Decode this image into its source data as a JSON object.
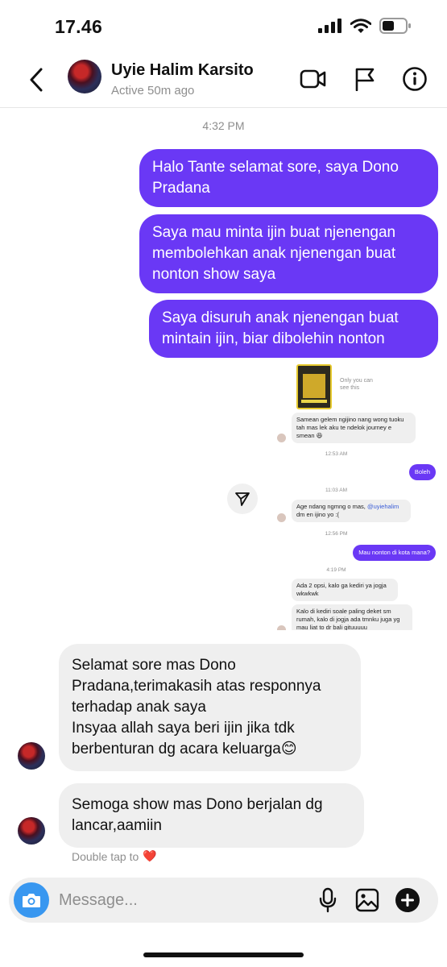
{
  "status_bar": {
    "time": "17.46"
  },
  "header": {
    "contact_name": "Uyie Halim Karsito",
    "contact_status": "Active 50m ago",
    "icons": [
      "back-icon",
      "video-call-icon",
      "flag-icon",
      "info-icon"
    ]
  },
  "conversation": {
    "timestamp": "4:32 PM",
    "outgoing": [
      {
        "text": "Halo Tante selamat sore, saya Dono Pradana"
      },
      {
        "text": "Saya mau minta ijin buat njenengan membolehkan anak njenengan buat nonton show saya"
      },
      {
        "text": "Saya disuruh anak njenengan buat mintain ijin, biar dibolehin nonton"
      }
    ],
    "shared_screenshot": {
      "only_you_can_see": "Only you can see this",
      "messages": [
        {
          "dir": "in",
          "text": "Samean gelem ngijino nang wong tuoku tah mas lek aku te ndelok journey e smean 😆"
        },
        {
          "dir": "time",
          "text": "12:53 AM"
        },
        {
          "dir": "out",
          "text": "Boleh"
        },
        {
          "dir": "time",
          "text": "11:03 AM"
        },
        {
          "dir": "in",
          "text": "Age ndang ngmng o mas, ",
          "mention": "@uyiehalim",
          "text_after": " dm en ijino yo :("
        },
        {
          "dir": "time",
          "text": "12:56 PM"
        },
        {
          "dir": "out",
          "text": "Mau nonton di kota mana?"
        },
        {
          "dir": "time",
          "text": "4:19 PM"
        },
        {
          "dir": "in",
          "text": "Ada 2 opsi, kalo ga kediri ya jogja wkwkwk"
        },
        {
          "dir": "in",
          "text": "Kalo di kediri soale paling deket sm rumah, kalo di jogja ada tmnku juga yg mau liat to dr bali gituuuuu"
        }
      ]
    },
    "incoming": [
      {
        "lines": [
          "Selamat sore mas Dono",
          "Pradana,terimakasih atas responnya",
          "terhadap anak saya",
          "Insyaa allah saya beri ijin jika tdk",
          "berbenturan dg acara keluarga😊"
        ]
      },
      {
        "lines": [
          "Semoga show mas Dono berjalan dg",
          "lancar,aamiin"
        ]
      }
    ],
    "double_tap": "Double tap to",
    "double_tap_emoji": "❤️"
  },
  "composer": {
    "placeholder": "Message...",
    "icons": [
      "camera-icon",
      "microphone-icon",
      "gallery-icon",
      "add-icon"
    ]
  },
  "colors": {
    "outgoing_bubble": "#6a38f5",
    "incoming_bubble": "#efefef",
    "camera_button": "#3897f0"
  }
}
